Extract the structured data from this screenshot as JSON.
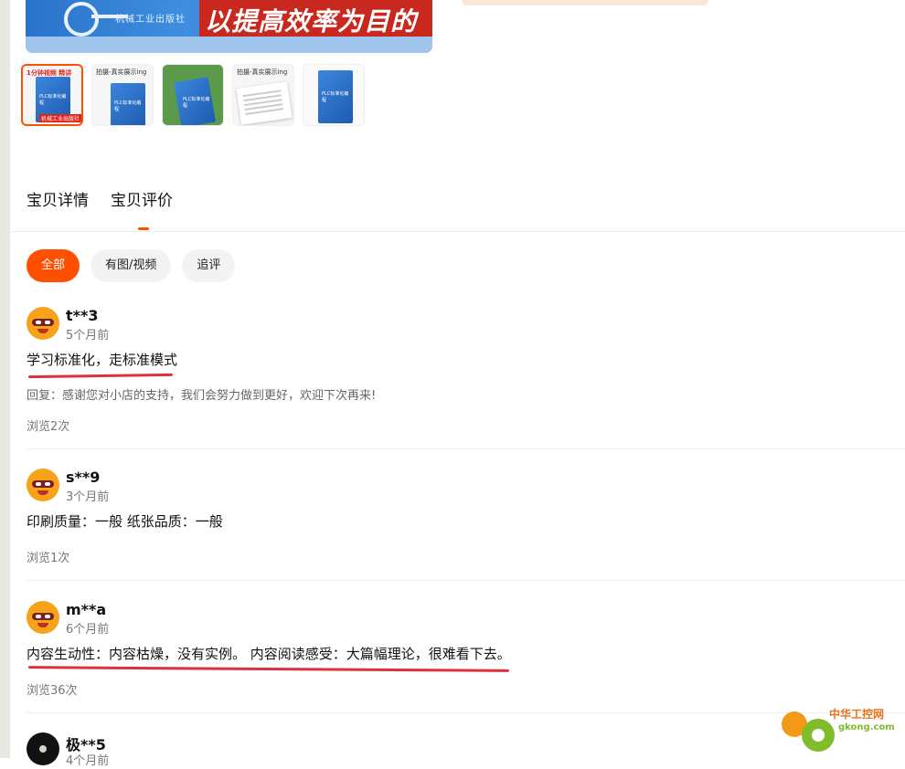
{
  "hero": {
    "publisher": "机械工业出版社",
    "slogan": "以提高效率为目的"
  },
  "thumbnails": [
    {
      "header": "1分钟视频 精讲",
      "cover_title": "PLC标准化编程",
      "badge": "机械工业出版社",
      "active": true
    },
    {
      "header": "拍摄-真实展示ing",
      "cover_title": "PLC标准化编程",
      "active": false
    },
    {
      "header": "",
      "cover_title": "PLC标准化编程",
      "active": false
    },
    {
      "header": "拍摄-真实展示ing",
      "cover_title": "",
      "active": false
    },
    {
      "header": "",
      "cover_title": "PLC标准化编程",
      "active": false
    }
  ],
  "tabs": [
    {
      "label": "宝贝详情"
    },
    {
      "label": "宝贝评价"
    }
  ],
  "filters": [
    {
      "label": "全部"
    },
    {
      "label": "有图/视频"
    },
    {
      "label": "追评"
    }
  ],
  "reviews": [
    {
      "nick": "t**3",
      "time": "5个月前",
      "content": "学习标准化，走标准模式",
      "reply": "回复：感谢您对小店的支持，我们会努力做到更好，欢迎下次再来!",
      "views": "浏览2次"
    },
    {
      "nick": "s**9",
      "time": "3个月前",
      "content": "印刷质量：一般 纸张品质：一般",
      "views": "浏览1次"
    },
    {
      "nick": "m**a",
      "time": "6个月前",
      "content": "内容生动性：内容枯燥，没有实例。 内容阅读感受：大篇幅理论，很难看下去。",
      "views": "浏览36次"
    },
    {
      "nick": "极**5",
      "time": "4个月前"
    }
  ],
  "watermark": {
    "name": "中华工控网",
    "url": "gkong.com"
  },
  "colors": {
    "accent": "#ff5000",
    "annotation": "#e0303a"
  },
  "icons": [
    "user-avatar-icon",
    "gear-icon"
  ]
}
